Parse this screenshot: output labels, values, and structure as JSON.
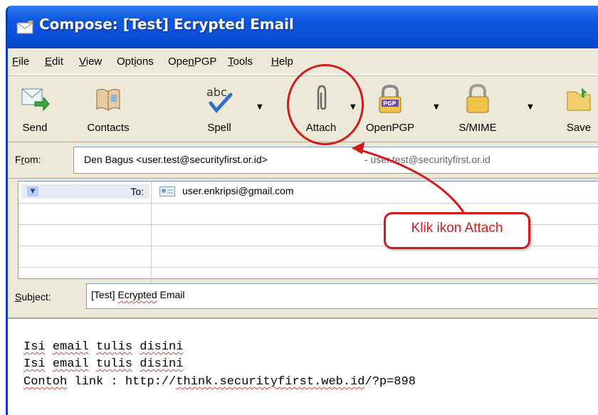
{
  "window": {
    "title": "Compose: [Test] Ecrypted Email"
  },
  "menu": [
    "File",
    "Edit",
    "View",
    "Options",
    "OpenPGP",
    "Tools",
    "Help"
  ],
  "toolbar": {
    "send": "Send",
    "contacts": "Contacts",
    "spell": "Spell",
    "attach": "Attach",
    "openpgp": "OpenPGP",
    "smime": "S/MIME",
    "save": "Save"
  },
  "from": {
    "label": "From:",
    "value": "Den Bagus <user.test@securityfirst.or.id>",
    "alt": "- user.test@securityfirst.or.id"
  },
  "recipients": {
    "type": "To:",
    "value": "user.enkripsi@gmail.com"
  },
  "subject": {
    "label": "Subject:",
    "value": "[Test] Ecrypted Email"
  },
  "body": {
    "lines": [
      "Isi email tulis disini",
      "Isi email tulis disini",
      "Contoh link : http://think.securityfirst.web.id/?p=898"
    ]
  },
  "annotation": {
    "text": "Klik ikon Attach"
  },
  "colors": {
    "accent": "#d21a1a",
    "titlebar": "#0a4fd6",
    "chrome": "#ece9d8"
  }
}
